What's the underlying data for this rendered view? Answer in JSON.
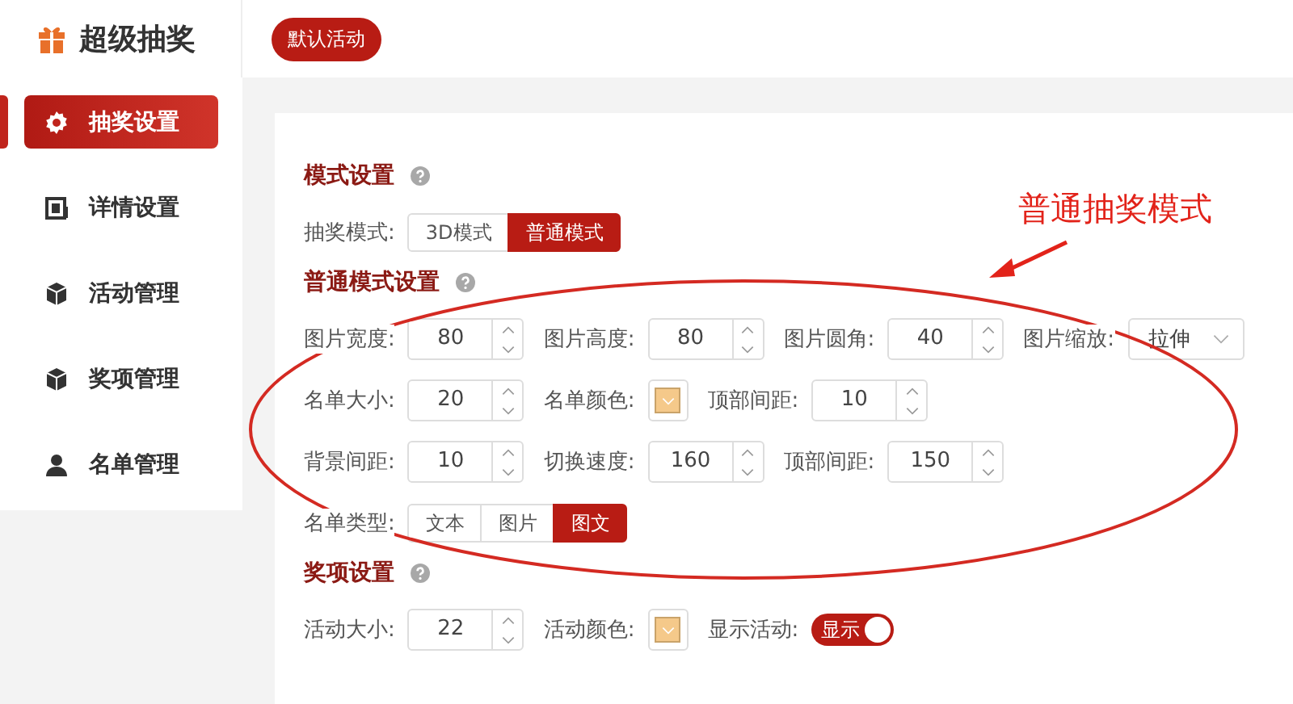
{
  "header": {
    "title": "超级抽奖",
    "activity_badge": "默认活动"
  },
  "sidebar": {
    "items": [
      {
        "label": "抽奖设置",
        "kind": "gear",
        "selected": true
      },
      {
        "label": "详情设置",
        "kind": "doc",
        "selected": false
      },
      {
        "label": "活动管理",
        "kind": "cube",
        "selected": false
      },
      {
        "label": "奖项管理",
        "kind": "cube",
        "selected": false
      },
      {
        "label": "名单管理",
        "kind": "person",
        "selected": false
      }
    ]
  },
  "sections": [
    {
      "title": "模式设置",
      "rows": [
        [
          {
            "kind": "segmented",
            "label": "抽奖模式:",
            "options": [
              {
                "label": "3D模式",
                "selected": false
              },
              {
                "label": "普通模式",
                "selected": true
              }
            ]
          }
        ]
      ]
    },
    {
      "title": "普通模式设置",
      "rows": [
        [
          {
            "kind": "number",
            "label": "图片宽度:",
            "value": "80"
          },
          {
            "kind": "number",
            "label": "图片高度:",
            "value": "80"
          },
          {
            "kind": "number",
            "label": "图片圆角:",
            "value": "40"
          },
          {
            "kind": "select",
            "label": "图片缩放:",
            "value": "拉伸"
          }
        ],
        [
          {
            "kind": "number",
            "label": "名单大小:",
            "value": "20"
          },
          {
            "kind": "color",
            "label": "名单颜色:",
            "color": "#f5c98a"
          },
          {
            "kind": "number",
            "label": "顶部间距:",
            "value": "10"
          }
        ],
        [
          {
            "kind": "number",
            "label": "背景间距:",
            "value": "10"
          },
          {
            "kind": "number",
            "label": "切换速度:",
            "value": "160"
          },
          {
            "kind": "number",
            "label": "顶部间距:",
            "value": "150"
          }
        ],
        [
          {
            "kind": "segmented",
            "label": "名单类型:",
            "options": [
              {
                "label": "文本",
                "selected": false
              },
              {
                "label": "图片",
                "selected": false
              },
              {
                "label": "图文",
                "selected": true
              }
            ]
          }
        ]
      ]
    },
    {
      "title": "奖项设置",
      "rows": [
        [
          {
            "kind": "number",
            "label": "活动大小:",
            "value": "22"
          },
          {
            "kind": "color",
            "label": "活动颜色:",
            "color": "#f5c98a"
          },
          {
            "kind": "toggle",
            "label": "显示活动:",
            "on": true,
            "text": "显示"
          }
        ]
      ]
    }
  ],
  "annotation": {
    "text": "普通抽奖模式"
  }
}
